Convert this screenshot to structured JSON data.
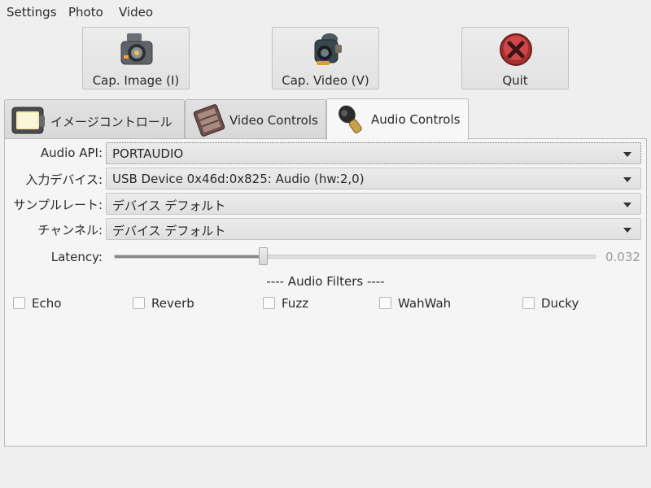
{
  "menu": {
    "items": [
      "Settings",
      "Photo",
      "Video"
    ]
  },
  "toolbar": {
    "capture_image_label": "Cap. Image (I)",
    "capture_video_label": "Cap. Video (V)",
    "quit_label": "Quit"
  },
  "tabs": [
    {
      "label": "イメージコントロール",
      "icon": "image-controls-icon",
      "active": false
    },
    {
      "label": "Video Controls",
      "icon": "video-controls-icon",
      "active": false
    },
    {
      "label": "Audio Controls",
      "icon": "microphone-icon",
      "active": true
    }
  ],
  "audio": {
    "api_label": "Audio API:",
    "api_value": "PORTAUDIO",
    "input_device_label": "入力デバイス:",
    "input_device_value": "USB Device 0x46d:0x825: Audio (hw:2,0)",
    "sample_rate_label": "サンプルレート:",
    "sample_rate_value": "デバイス デフォルト",
    "channels_label": "チャンネル:",
    "channels_value": "デバイス デフォルト",
    "latency_label": "Latency:",
    "latency_value": "0.032",
    "latency_fraction": 0.31,
    "filters_title": "---- Audio Filters ----",
    "filters": [
      {
        "label": "Echo",
        "checked": false
      },
      {
        "label": "Reverb",
        "checked": false
      },
      {
        "label": "Fuzz",
        "checked": false
      },
      {
        "label": "WahWah",
        "checked": false
      },
      {
        "label": "Ducky",
        "checked": false
      }
    ]
  },
  "colors": {
    "window_bg": "#efefef",
    "panel_bg": "#f5f5f5",
    "quit_red": "#c8393a"
  }
}
